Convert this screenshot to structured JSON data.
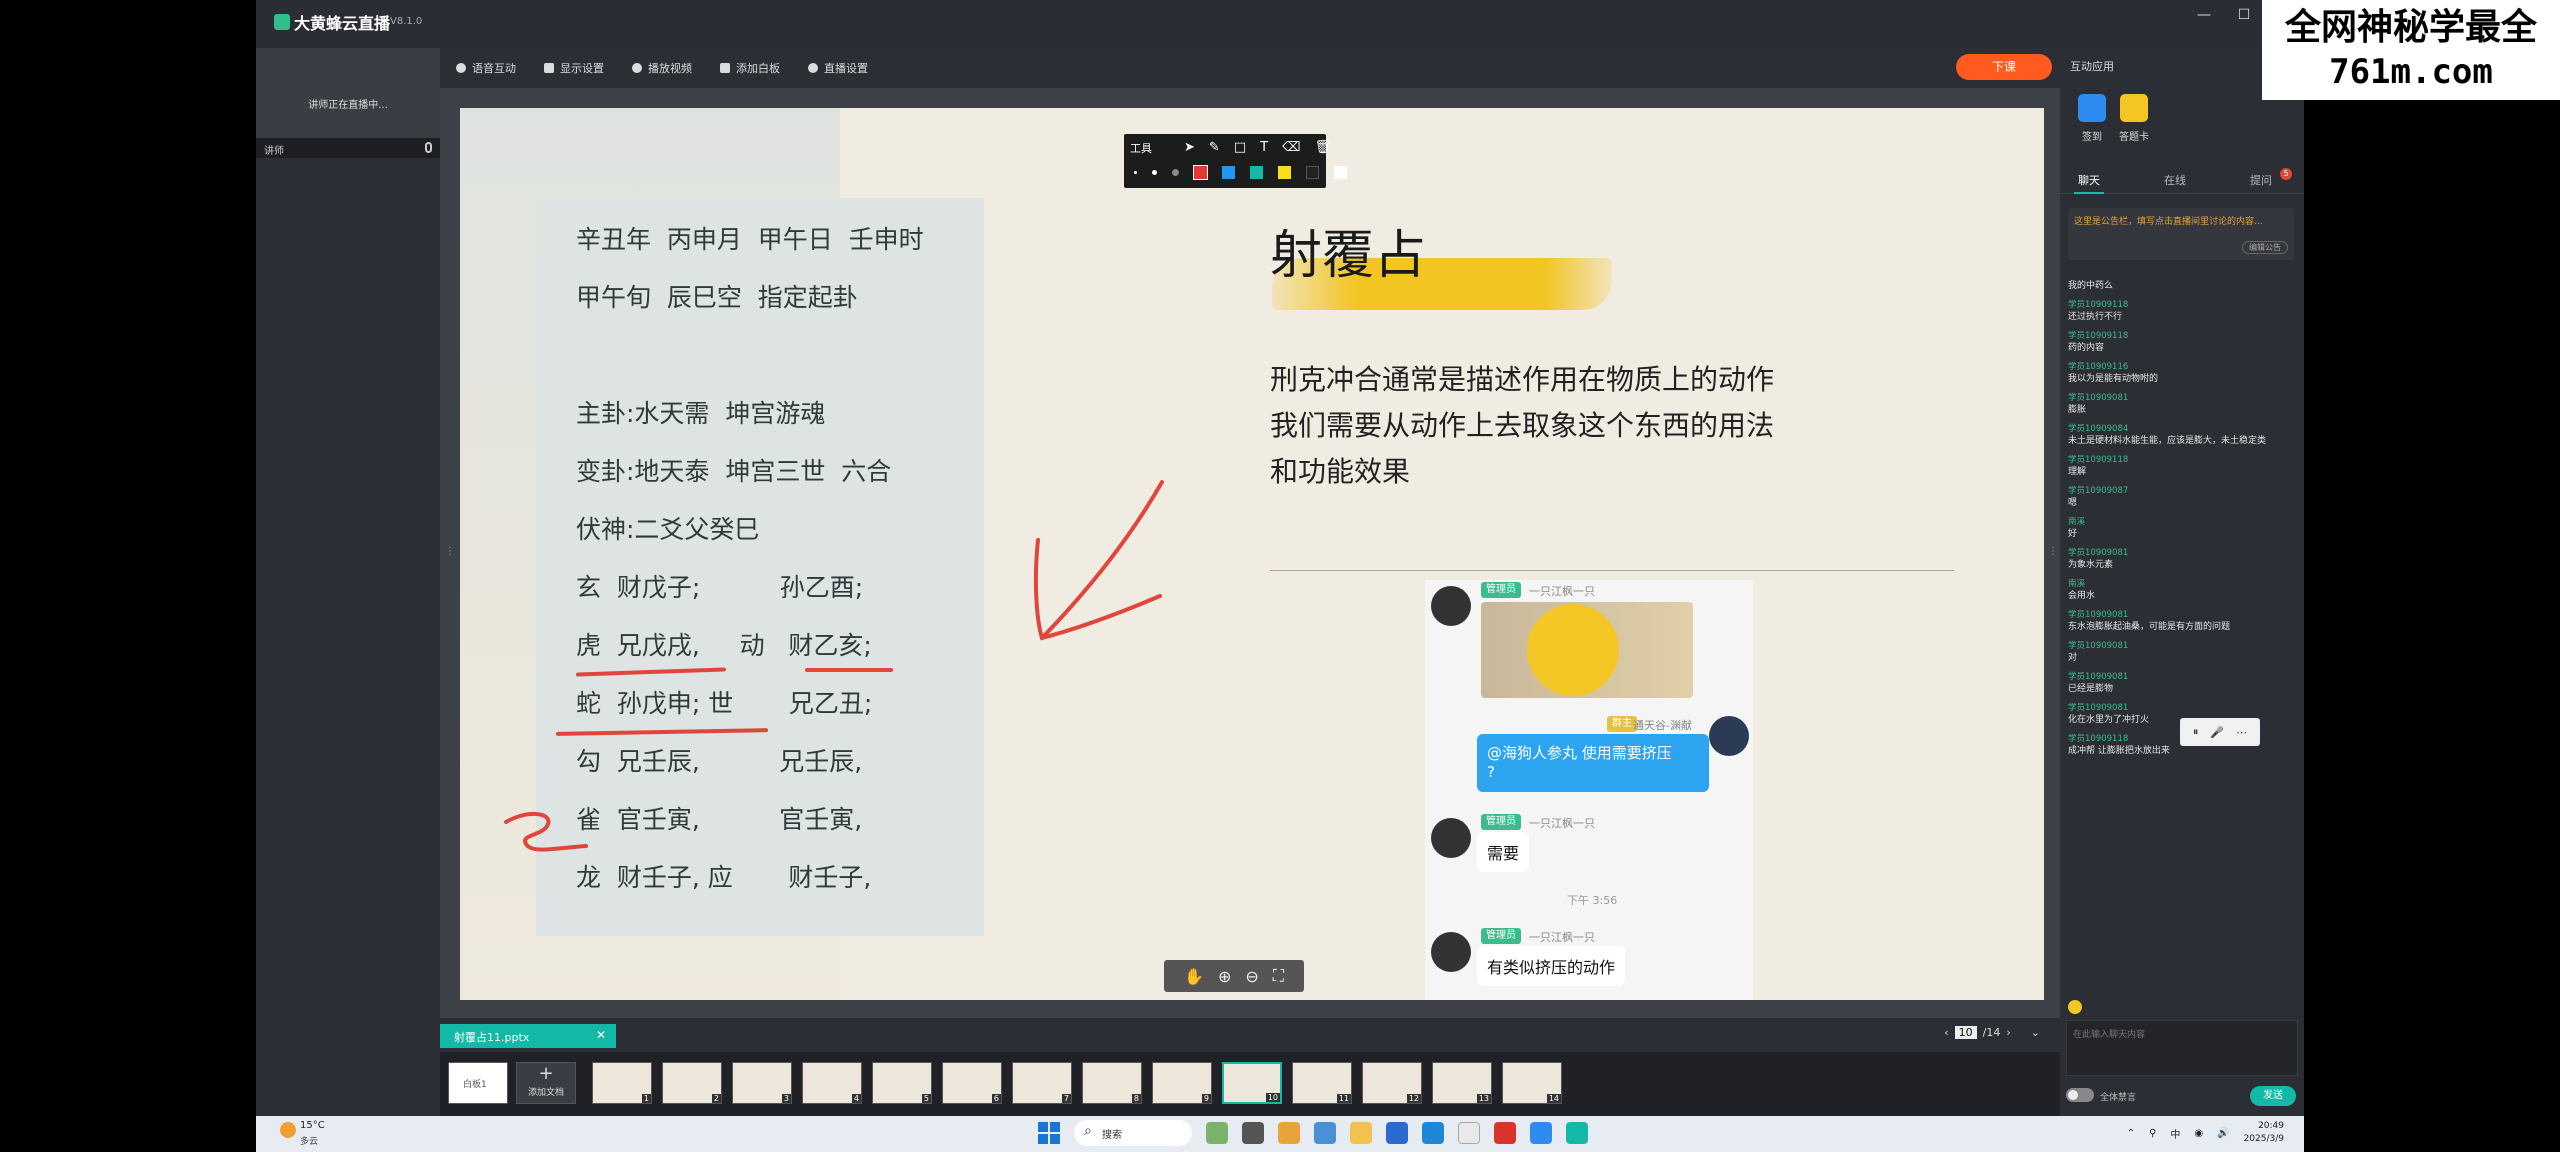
{
  "watermark": {
    "line1": "全网神秘学最全",
    "line2": "761m.com"
  },
  "titlebar": {
    "app_name": "大黄蜂云直播",
    "version": "V8.1.0",
    "minimize": "—",
    "maximize": "☐",
    "close": "✕"
  },
  "left": {
    "preview_text": "讲师正在直播中...",
    "lecturer_label": "讲师"
  },
  "toolbar": {
    "items": [
      "语音互动",
      "显示设置",
      "播放视频",
      "添加白板",
      "直播设置"
    ],
    "end_label": "下课"
  },
  "annotation": {
    "label": "工具",
    "tools": [
      "➤",
      "✎",
      "□",
      "T",
      "⌫",
      "🗑"
    ],
    "colors": [
      "#e53935",
      "#2196f3",
      "#14b8a6",
      "#f7e01b",
      "#222222",
      "#ffffff"
    ]
  },
  "slide": {
    "gua_lines": [
      "辛丑年  丙申月  甲午日  壬申时",
      "甲午旬  辰巳空  指定起卦",
      "主卦:水天需  坤宫游魂",
      "变卦:地天泰  坤宫三世  六合",
      "伏神:二爻父癸巳",
      "玄  财戊子;          孙乙酉;",
      "虎  兄戊戌,     动   财乙亥;",
      "蛇  孙戊申; 世       兄乙丑;",
      "勾  兄壬辰,          兄壬辰,",
      "雀  官壬寅,          官壬寅,",
      "龙  财壬子, 应       财壬子,"
    ],
    "title": "射覆占",
    "body": [
      "刑克冲合通常是描述作用在物质上的动作",
      "我们需要从动作上去取象这个东西的用法",
      "和功能效果"
    ],
    "chat": {
      "badge1": "管理员",
      "name1": "一只江枫一只",
      "badge2": "群主",
      "name2": "通天谷-渊献",
      "blue_msg_line1": "@海狗人参丸 使用需要挤压",
      "blue_msg_line2": "?",
      "reply1": "需要",
      "time": "下午 3:56",
      "reply2": "有类似挤压的动作"
    },
    "zoom_icons": [
      "✋",
      "⊕",
      "⊖",
      "⛶"
    ]
  },
  "filebar": {
    "tab_name": "射覆占11.pptx",
    "close": "✕",
    "current_page": "10",
    "total_pages": "/14",
    "prev": "‹",
    "next": "›",
    "expand": "⌄"
  },
  "thumbs": {
    "whiteboard_label": "白板1",
    "add_label": "添加文档",
    "add_plus": "+",
    "numbers": [
      "1",
      "2",
      "3",
      "4",
      "5",
      "6",
      "7",
      "8",
      "9",
      "10",
      "11",
      "12",
      "13",
      "14"
    ],
    "active_index": 10
  },
  "rpanel": {
    "title": "互动应用",
    "apps": [
      "签到",
      "答题卡"
    ],
    "tabs": [
      "聊天",
      "在线",
      "提问"
    ],
    "tab_badge": "5",
    "notice": "这里是公告栏，填写点击直播间里讨论的内容...",
    "notice_btn": "编辑公告",
    "messages": [
      {
        "name": "我的中药么",
        "text": ""
      },
      {
        "name": "学员10909118",
        "text": "还过执行不行"
      },
      {
        "name": "学员10909118",
        "text": "药的内容"
      },
      {
        "name": "学员10909116",
        "text": "我以为是能有动物咐的"
      },
      {
        "name": "学员10909081",
        "text": "膨胀"
      },
      {
        "name": "学员10909084",
        "text": "未土是硬材料水能生能，应该是膨大，未土稳定类"
      },
      {
        "name": "学员10909118",
        "text": "理解"
      },
      {
        "name": "学员10909087",
        "text": "嗯"
      },
      {
        "name": "南溪",
        "text": "好"
      },
      {
        "name": "学员10909081",
        "text": "为象水元素"
      },
      {
        "name": "南溪",
        "text": "会用水"
      },
      {
        "name": "学员10909081",
        "text": "东水泡膨胀起油桑，可能是有方面的问题"
      },
      {
        "name": "学员10909081",
        "text": "对"
      },
      {
        "name": "学员10909081",
        "text": "已经是膨物"
      },
      {
        "name": "学员10909081",
        "text": "化在水里为了冲打火"
      },
      {
        "name": "学员10909118",
        "text": "成冲帮 让膨胀把水放出来"
      }
    ],
    "float_icons": [
      "⏸",
      "🎤",
      "⋯"
    ],
    "input_placeholder": "在此输入聊天内容",
    "toggle_label": "全体禁言",
    "send_label": "发送"
  },
  "taskbar": {
    "weather_temp": "15°C",
    "weather_desc": "多云",
    "search_label": "搜索",
    "tray": [
      "⌃",
      "⚲",
      "中",
      "◉",
      "🔊"
    ],
    "time": "20:49",
    "date": "2025/3/9"
  }
}
